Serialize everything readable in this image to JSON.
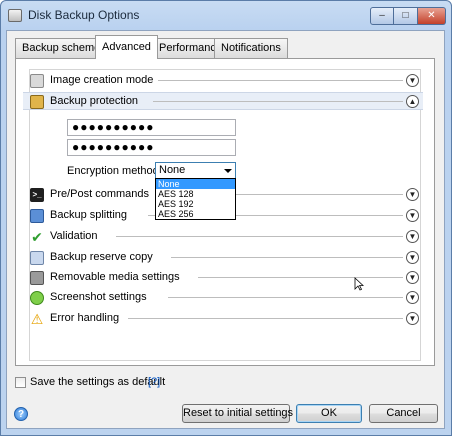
{
  "window": {
    "title": "Disk Backup Options",
    "controls": {
      "minimize": "–",
      "maximize": "□",
      "close": "✕"
    }
  },
  "tabs": [
    {
      "label": "Backup scheme",
      "active": false
    },
    {
      "label": "Advanced",
      "active": true
    },
    {
      "label": "Performance",
      "active": false
    },
    {
      "label": "Notifications",
      "active": false
    }
  ],
  "sections": [
    {
      "label": "Image creation mode",
      "icon": "disk-image-icon",
      "expanded": false
    },
    {
      "label": "Backup protection",
      "icon": "lock-icon",
      "expanded": true
    },
    {
      "label": "Pre/Post commands",
      "icon": "command-prompt-icon",
      "expanded": false
    },
    {
      "label": "Backup splitting",
      "icon": "split-icon",
      "expanded": false
    },
    {
      "label": "Validation",
      "icon": "checkmark-icon",
      "expanded": false
    },
    {
      "label": "Backup reserve copy",
      "icon": "reserve-copy-icon",
      "expanded": false
    },
    {
      "label": "Removable media settings",
      "icon": "removable-media-icon",
      "expanded": false
    },
    {
      "label": "Screenshot settings",
      "icon": "speech-bubble-icon",
      "expanded": false
    },
    {
      "label": "Error handling",
      "icon": "warning-icon",
      "expanded": false
    }
  ],
  "protection": {
    "password_mask": "●●●●●●●●●●",
    "confirm_mask": "●●●●●●●●●●",
    "encryption_label": "Encryption method:",
    "encryption_value": "None",
    "encryption_options": [
      "None",
      "AES 128",
      "AES 192",
      "AES 256"
    ]
  },
  "footer": {
    "save_default_label": "Save the settings as default",
    "help_link": "[?]",
    "reset_label": "Reset to initial settings",
    "ok_label": "OK",
    "cancel_label": "Cancel"
  },
  "colors": {
    "selection": "#3399ff",
    "link": "#0b57c2",
    "highlight_row": "#e8eef7"
  }
}
